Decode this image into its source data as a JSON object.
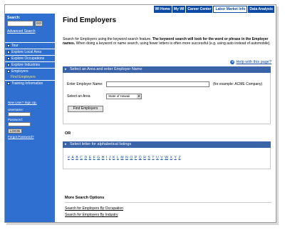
{
  "topnav": {
    "tabs": [
      {
        "label": "WI Home"
      },
      {
        "label": "My WI"
      },
      {
        "label": "Career Center"
      },
      {
        "label": "Labor Market Info"
      },
      {
        "label": "Data Analysis"
      }
    ],
    "active_tab": "Labor Market Info"
  },
  "sidebar": {
    "search_label": "Search:",
    "search_value": "",
    "go_label": "GO",
    "advanced_search": "Advanced Search",
    "items": [
      {
        "label": "Tour"
      },
      {
        "label": "Explore Local Area"
      },
      {
        "label": "Explore Occupations"
      },
      {
        "label": "Explore Industries"
      },
      {
        "label": "Employers"
      },
      {
        "label": "Training Information"
      }
    ],
    "sub_item": "Find Employers",
    "new_user": "New User? Sign Up.",
    "username_label": "Username:",
    "password_label": "Password:",
    "login_label": "LOGIN",
    "forgot": "Forgot Password?"
  },
  "main": {
    "title": "Find Employers",
    "intro_plain": "Search for Employers using the keyword search feature. ",
    "intro_bold": "The keyword search will look for the word or phrase in the Employer names.",
    "intro_tail": " When doing a keyword or name search, using fewer letters is often more successful (e.g. using auto instead of automobile).",
    "help_link": "Help with this page?",
    "section1_title": "Select an Area and enter Employer Name",
    "employer_name_label": "Enter Employer Name:",
    "employer_name_value": "",
    "example_text": "(for example: ACME Company)",
    "area_label": "Select an Area",
    "area_value": "State of Hawaii",
    "find_button": "Find Employers",
    "or_label": "OR",
    "section2_title": "Select letter for alphabetical listings",
    "letters": [
      "#",
      "A",
      "B",
      "C",
      "D",
      "E",
      "F",
      "G",
      "H",
      "I",
      "J",
      "K",
      "L",
      "M",
      "N",
      "O",
      "P",
      "Q",
      "R",
      "S",
      "T",
      "U",
      "V",
      "W",
      "X",
      "Y",
      "Z"
    ],
    "more_title": "More Search Options",
    "more_links": [
      {
        "label": "Search for Employers By Occupation"
      },
      {
        "label": "Search for Employers By Industry"
      }
    ]
  },
  "colors": {
    "nav_blue": "#0b4aa3",
    "sidebar_blue": "#2f6fcf",
    "panel_header": "#3a63a8",
    "sub_item": "#ffe27a"
  }
}
